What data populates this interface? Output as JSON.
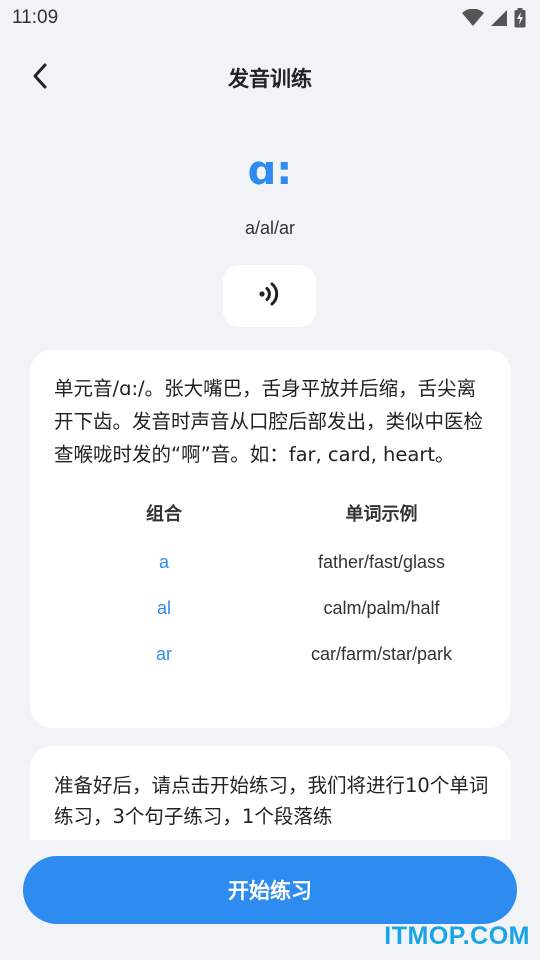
{
  "status_bar": {
    "time": "11:09",
    "icons": [
      "wifi-icon",
      "signal-icon",
      "battery-icon"
    ]
  },
  "header": {
    "back_icon": "chevron-left-icon",
    "title": "发音训练"
  },
  "phoneme": {
    "symbol": "ɑ:",
    "spelling": "a/al/ar",
    "play_icon": "speaker-wave-icon"
  },
  "description": {
    "text": "单元音/ɑ:/。张大嘴巴，舌身平放并后缩，舌尖离开下齿。发音时声音从口腔后部发出，类似中医检查喉咙时发的“啊”音。如：far, card, heart。",
    "table": {
      "headers": [
        "组合",
        "单词示例"
      ],
      "rows": [
        {
          "combo": "a",
          "words": "father/fast/glass"
        },
        {
          "combo": "al",
          "words": "calm/palm/half"
        },
        {
          "combo": "ar",
          "words": "car/farm/star/park"
        }
      ]
    }
  },
  "intro": {
    "text": "准备好后，请点击开始练习，我们将进行10个单词练习，3个句子练习，1个段落练"
  },
  "actions": {
    "start_label": "开始练习"
  },
  "watermark": "ITMOP.COM",
  "colors": {
    "accent": "#2e8bf0",
    "background": "#f1f3f6",
    "card": "#ffffff",
    "watermark": "#1aa4e8"
  }
}
